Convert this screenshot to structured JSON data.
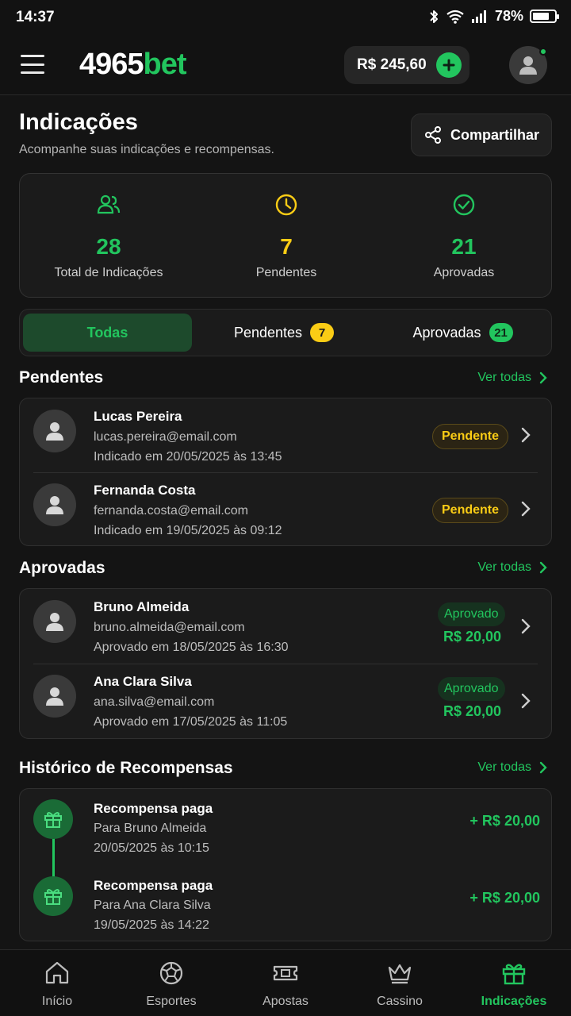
{
  "status_bar": {
    "time": "14:37",
    "battery": "78%",
    "battery_level": 0.78
  },
  "header": {
    "logo_number": "4965",
    "logo_text": "bet",
    "balance": "R$ 245,60"
  },
  "page": {
    "title": "Indicações",
    "subtitle": "Acompanhe suas indicações e recompensas.",
    "share_label": "Compartilhar"
  },
  "stats": [
    {
      "value": "28",
      "label": "Total de Indicações",
      "color": "#22c55e",
      "icon": "users-icon"
    },
    {
      "value": "7",
      "label": "Pendentes",
      "color": "#facc15",
      "icon": "clock-icon"
    },
    {
      "value": "21",
      "label": "Aprovadas",
      "color": "#22c55e",
      "icon": "check-circle-icon"
    }
  ],
  "tabs": [
    {
      "label": "Todas",
      "active": true
    },
    {
      "label": "Pendentes",
      "count": "7"
    },
    {
      "label": "Aprovadas",
      "count": "21"
    }
  ],
  "pending": {
    "title": "Pendentes",
    "see_all": "Ver todas",
    "items": [
      {
        "name": "Lucas Pereira",
        "email": "lucas.pereira@email.com",
        "date": "Indicado em 20/05/2025 às 13:45",
        "status": "Pendente"
      },
      {
        "name": "Fernanda Costa",
        "email": "fernanda.costa@email.com",
        "date": "Indicado em 19/05/2025 às 09:12",
        "status": "Pendente"
      }
    ]
  },
  "approved": {
    "title": "Aprovadas",
    "see_all": "Ver todas",
    "items": [
      {
        "name": "Bruno Almeida",
        "email": "bruno.almeida@email.com",
        "date": "Aprovado em 18/05/2025 às 16:30",
        "status": "Aprovado",
        "amount": "R$ 20,00"
      },
      {
        "name": "Ana Clara Silva",
        "email": "ana.silva@email.com",
        "date": "Aprovado em 17/05/2025 às 11:05",
        "status": "Aprovado",
        "amount": "R$ 20,00"
      }
    ]
  },
  "history": {
    "title": "Histórico de Recompensas",
    "see_all": "Ver todas",
    "items": [
      {
        "title": "Recompensa paga",
        "sub": "Para Bruno Almeida",
        "date": "20/05/2025 às 10:15",
        "amount": "+ R$ 20,00"
      },
      {
        "title": "Recompensa paga",
        "sub": "Para Ana Clara Silva",
        "date": "19/05/2025 às 14:22",
        "amount": "+ R$ 20,00"
      }
    ]
  },
  "bottom_nav": [
    {
      "label": "Início",
      "icon": "home-icon"
    },
    {
      "label": "Esportes",
      "icon": "ball-icon"
    },
    {
      "label": "Apostas",
      "icon": "ticket-icon"
    },
    {
      "label": "Cassino",
      "icon": "crown-icon"
    },
    {
      "label": "Indicações",
      "icon": "gift-icon",
      "active": true
    }
  ],
  "colors": {
    "accent": "#22c55e",
    "warning": "#facc15",
    "background": "#141414",
    "card": "#1b1b1b"
  }
}
